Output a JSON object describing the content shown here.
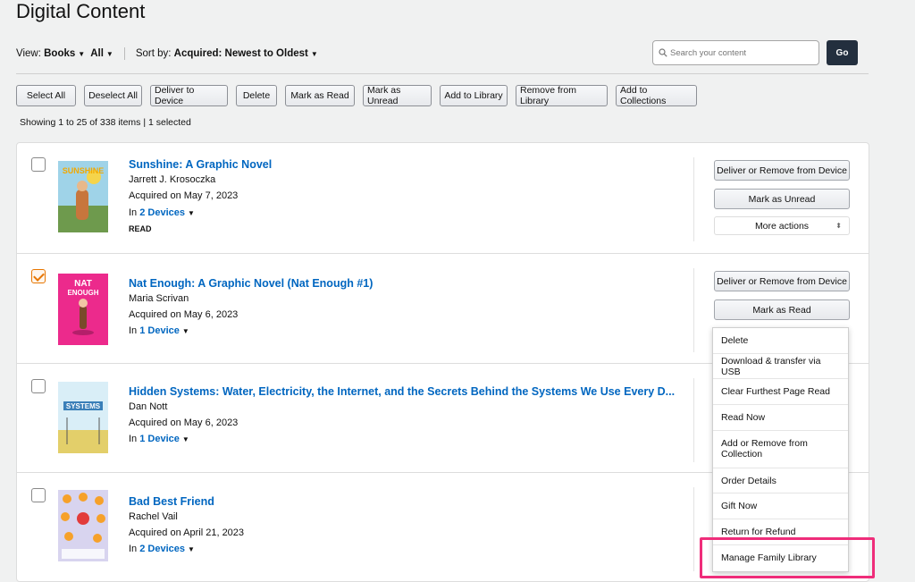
{
  "page": {
    "title": "Digital Content"
  },
  "view": {
    "label": "View:",
    "type_value": "Books",
    "filter_value": "All",
    "sort_label": "Sort by:",
    "sort_value": "Acquired: Newest to Oldest"
  },
  "search": {
    "placeholder": "Search your content",
    "go_label": "Go"
  },
  "toolbar": {
    "select_all": "Select All",
    "deselect_all": "Deselect All",
    "deliver": "Deliver to Device",
    "delete": "Delete",
    "mark_read": "Mark as Read",
    "mark_unread": "Mark as Unread",
    "add_library": "Add to Library",
    "remove_library": "Remove from Library",
    "add_collections": "Add to Collections"
  },
  "status": {
    "showing": "Showing 1 to 25 of 338 items",
    "selected": "| 1 selected"
  },
  "books": [
    {
      "title": "Sunshine: A Graphic Novel",
      "author": "Jarrett J. Krosoczka",
      "acquired": "Acquired on May 7, 2023",
      "devices_prefix": "In",
      "devices": "2 Devices",
      "tag": "READ",
      "checked": false,
      "cover_text": "SUNSHINE",
      "actions": {
        "deliver": "Deliver or Remove from Device",
        "mark": "Mark as Unread",
        "more": "More actions"
      }
    },
    {
      "title": "Nat Enough: A Graphic Novel (Nat Enough #1)",
      "author": "Maria Scrivan",
      "acquired": "Acquired on May 6, 2023",
      "devices_prefix": "In",
      "devices": "1 Device",
      "tag": "",
      "checked": true,
      "cover_text": "NAT ENOUGH",
      "actions": {
        "deliver": "Deliver or Remove from Device",
        "mark": "Mark as Read"
      }
    },
    {
      "title": "Hidden Systems: Water, Electricity, the Internet, and the Secrets Behind the Systems We Use Every D...",
      "author": "Dan Nott",
      "acquired": "Acquired on May 6, 2023",
      "devices_prefix": "In",
      "devices": "1 Device",
      "tag": "",
      "checked": false,
      "cover_text": "SYSTEMS"
    },
    {
      "title": "Bad Best Friend",
      "author": "Rachel Vail",
      "acquired": "Acquired on April 21, 2023",
      "devices_prefix": "In",
      "devices": "2 Devices",
      "tag": "",
      "checked": false,
      "cover_text": "rachel vail"
    }
  ],
  "menu": {
    "items": [
      "Delete",
      "Download & transfer via USB",
      "Clear Furthest Page Read",
      "Read Now",
      "Add or Remove from Collection",
      "Order Details",
      "Gift Now",
      "Return for Refund",
      "Manage Family Library"
    ]
  },
  "colors": {
    "link": "#0066c0",
    "highlight": "#ef2d7a",
    "check": "#e77600"
  }
}
